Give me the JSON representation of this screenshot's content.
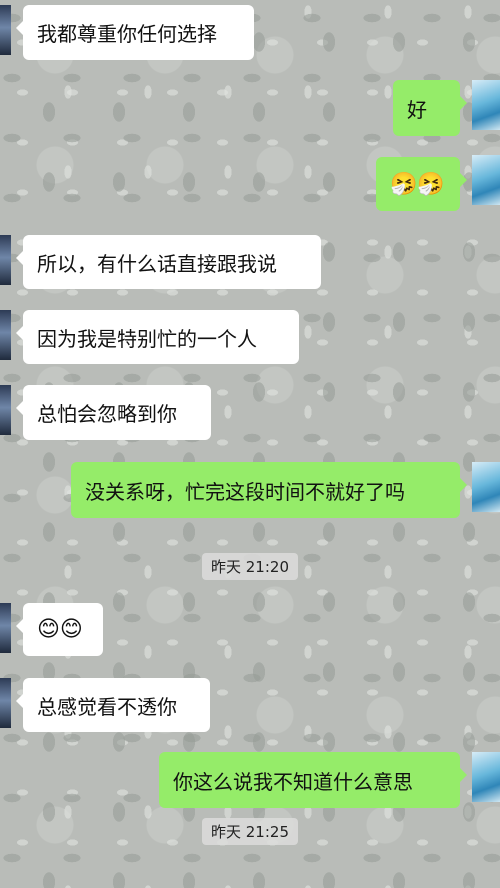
{
  "messages": [
    {
      "side": "left",
      "text": "我都尊重你任何选择"
    },
    {
      "side": "right",
      "text": "好"
    },
    {
      "side": "right",
      "text": "🤧🤧"
    },
    {
      "side": "left",
      "text": "所以，有什么话直接跟我说"
    },
    {
      "side": "left",
      "text": "因为我是特别忙的一个人"
    },
    {
      "side": "left",
      "text": "总怕会忽略到你"
    },
    {
      "side": "right",
      "text": "没关系呀，忙完这段时间不就好了吗"
    },
    {
      "side": "left",
      "text": "😊😊"
    },
    {
      "side": "left",
      "text": "总感觉看不透你"
    },
    {
      "side": "right",
      "text": "你这么说我不知道什么意思"
    }
  ],
  "timestamps": [
    "昨天 21:20",
    "昨天 21:25"
  ],
  "colors": {
    "incoming": "#ffffff",
    "outgoing": "#95ec69"
  }
}
